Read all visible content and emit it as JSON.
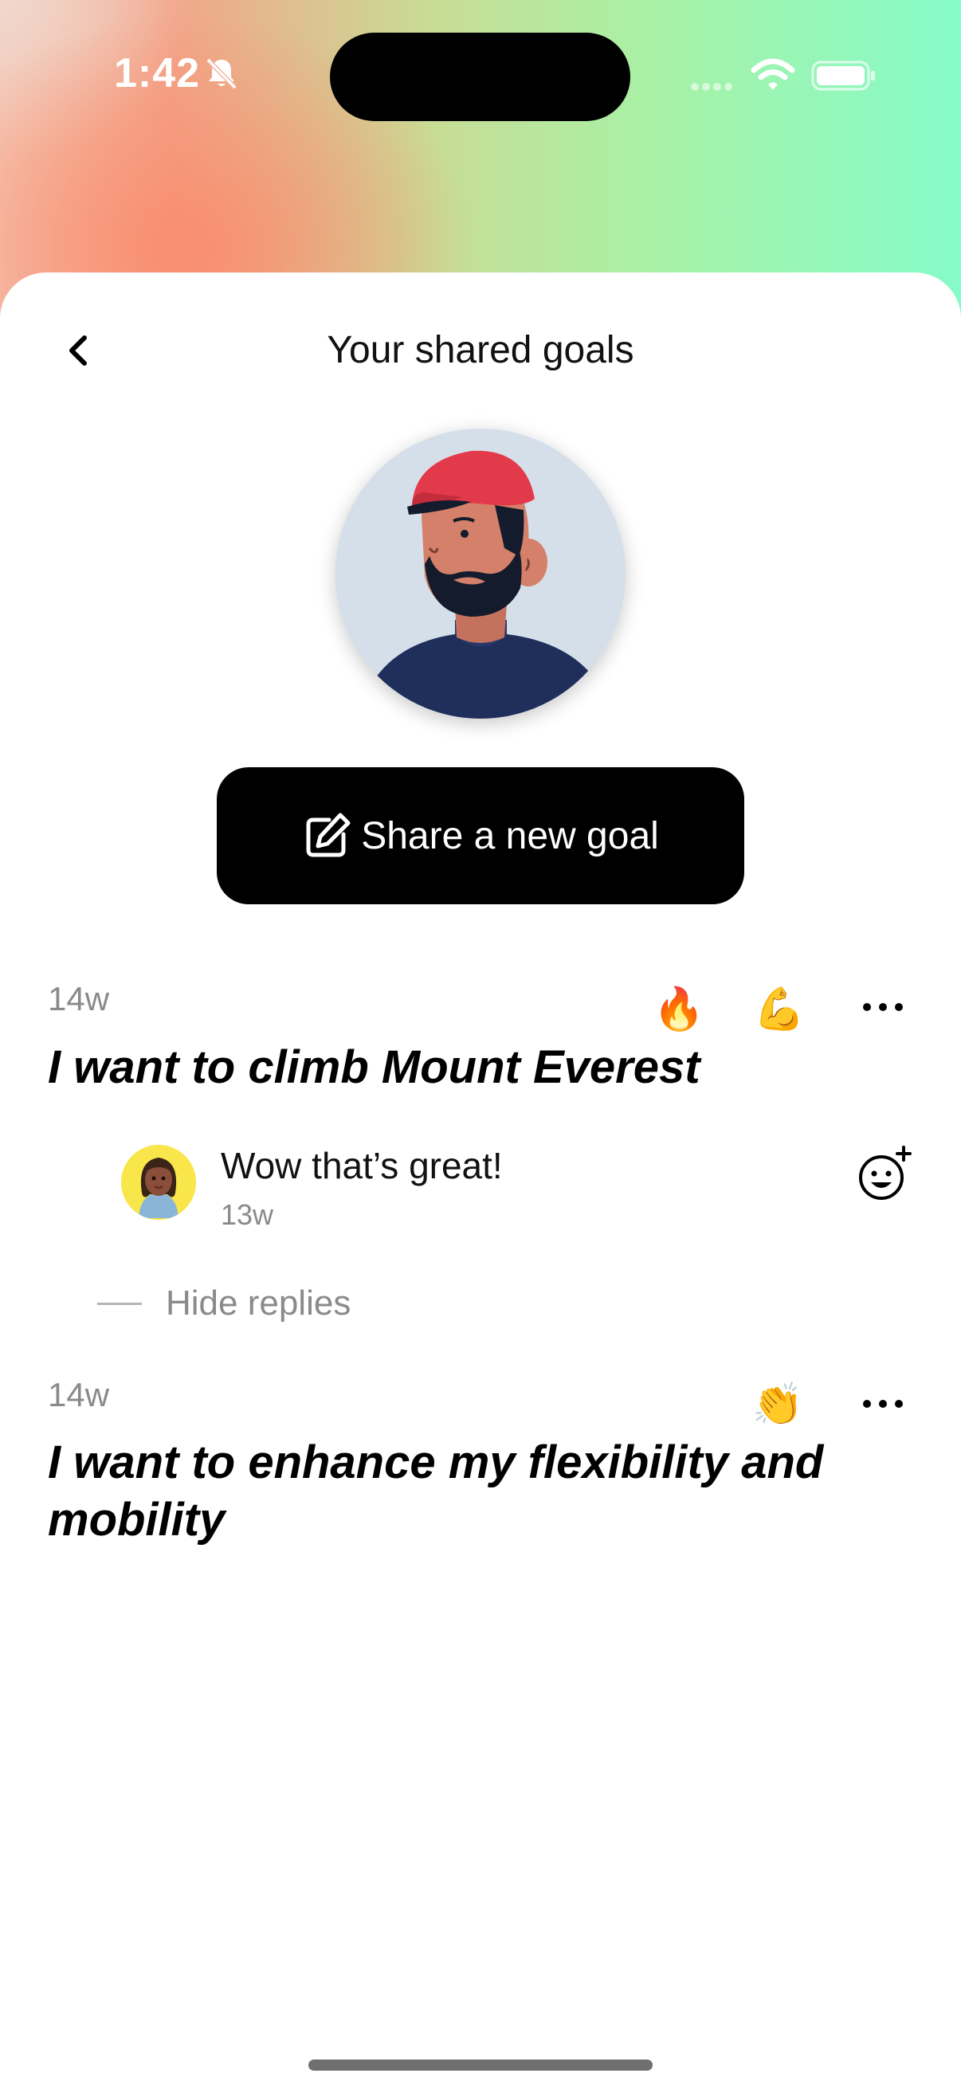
{
  "status_bar": {
    "time": "1:42",
    "icons": [
      "bell-off-icon",
      "signal-icon",
      "wifi-icon",
      "battery-icon"
    ]
  },
  "header": {
    "title": "Your shared goals",
    "back_icon": "chevron-left-icon"
  },
  "profile": {
    "avatar": "illustrated-man-avatar"
  },
  "share_button": {
    "label": "Share a new goal",
    "icon": "edit-icon"
  },
  "goals": [
    {
      "time": "14w",
      "text": "I want to climb Mount Everest",
      "reactions": [
        "🔥",
        "💪"
      ],
      "replies": [
        {
          "avatar": "woman-avatar",
          "text": "Wow that’s great!",
          "time": "13w"
        }
      ],
      "hide_replies_label": "Hide replies"
    },
    {
      "time": "14w",
      "text": "I want to enhance my flexibility and mobility",
      "reactions": [
        "👏"
      ]
    }
  ],
  "colors": {
    "gradient": [
      "#f2a58a",
      "#c8dc95",
      "#86fbc8"
    ],
    "button": "#000000",
    "muted_text": "#8a8a8a"
  }
}
